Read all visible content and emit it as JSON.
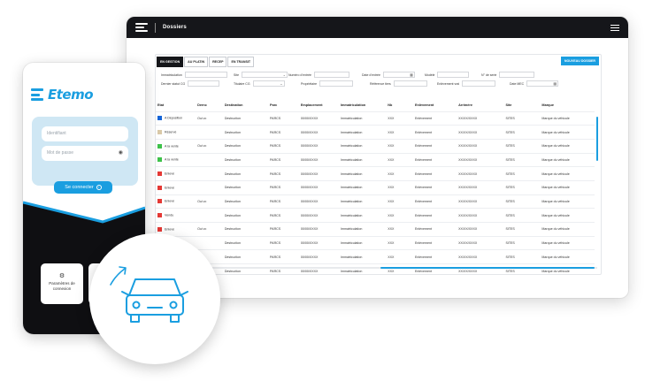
{
  "desktop": {
    "title": "Dossiers",
    "tabs": [
      "EN GESTION",
      "AU PLATIN",
      "RECEP",
      "EN TRANSIT"
    ],
    "new_button": "NOUVEAU DOSSIER",
    "filters": {
      "immatriculation": "Immatriculation",
      "site": "Site",
      "numero_entree": "Numéro d'entrée",
      "date_entree": "Date d'entrée",
      "modele": "Modèle",
      "no_serie": "N° de serie",
      "dernier_statut": "Dernier statut CG",
      "titulaire_cg": "Titulaire CG",
      "proprietaire": "Propriétaire",
      "reference_tiers": "Référence tiers",
      "enlevement_vr": "Enlèvement vrai",
      "date_mec": "Date MEC"
    },
    "columns": [
      "Etat",
      "Dernc",
      "Destination",
      "Parc",
      "Emplacement",
      "Immatriculation",
      "Nb",
      "Enlèvement",
      "Arrimère",
      "Site",
      "Marque"
    ],
    "rows": [
      {
        "etat": "A Déposition",
        "color": "#1565d8",
        "dernc": "Oui vc",
        "destination": "Destruction",
        "parc": "PARCS",
        "empl": "00/00/XXXX",
        "immat": "Immatriculation",
        "nb": "XXX",
        "enl": "Enlèvement",
        "arr": "XX/XX/XXXX",
        "site": "SITES",
        "marque": "Marque du véhicule"
      },
      {
        "etat": "Réservé",
        "color": "#d9c9a8",
        "dernc": "",
        "destination": "Destruction",
        "parc": "PARCS",
        "empl": "00/00/XXXX",
        "immat": "Immatriculation",
        "nb": "XXX",
        "enl": "Enlèvement",
        "arr": "XX/XX/XXXX",
        "site": "SITES",
        "marque": "Marque du véhicule"
      },
      {
        "etat": "A la vente",
        "color": "#3ec24a",
        "dernc": "Oui vc",
        "destination": "Destruction",
        "parc": "PARCS",
        "empl": "00/00/XXXX",
        "immat": "Immatriculation",
        "nb": "XXX",
        "enl": "Enlèvement",
        "arr": "XX/XX/XXXX",
        "site": "SITES",
        "marque": "Marque du véhicule"
      },
      {
        "etat": "A la vente",
        "color": "#3ec24a",
        "dernc": "",
        "destination": "Destruction",
        "parc": "PARCS",
        "empl": "00/00/XXXX",
        "immat": "Immatriculation",
        "nb": "XXX",
        "enl": "Enlèvement",
        "arr": "XX/XX/XXXX",
        "site": "SITES",
        "marque": "Marque du véhicule"
      },
      {
        "etat": "Enlevé",
        "color": "#e53935",
        "dernc": "",
        "destination": "Destruction",
        "parc": "PARCS",
        "empl": "00/00/XXXX",
        "immat": "Immatriculation",
        "nb": "XXX",
        "enl": "Enlèvement",
        "arr": "XX/XX/XXXX",
        "site": "SITES",
        "marque": "Marque du véhicule"
      },
      {
        "etat": "Enlevé",
        "color": "#e53935",
        "dernc": "",
        "destination": "Destruction",
        "parc": "PARCS",
        "empl": "00/00/XXXX",
        "immat": "Immatriculation",
        "nb": "XXX",
        "enl": "Enlèvement",
        "arr": "XX/XX/XXXX",
        "site": "SITES",
        "marque": "Marque du véhicule"
      },
      {
        "etat": "Enlevé",
        "color": "#e53935",
        "dernc": "Oui vc",
        "destination": "Destruction",
        "parc": "PARCS",
        "empl": "00/00/XXXX",
        "immat": "Immatriculation",
        "nb": "XXX",
        "enl": "Enlèvement",
        "arr": "XX/XX/XXXX",
        "site": "SITES",
        "marque": "Marque du véhicule"
      },
      {
        "etat": "Vendu",
        "color": "#e53935",
        "dernc": "",
        "destination": "Destruction",
        "parc": "PARCS",
        "empl": "00/00/XXXX",
        "immat": "Immatriculation",
        "nb": "XXX",
        "enl": "Enlèvement",
        "arr": "XX/XX/XXXX",
        "site": "SITES",
        "marque": "Marque du véhicule"
      },
      {
        "etat": "Enlevé",
        "color": "#e53935",
        "dernc": "Oui vc",
        "destination": "Destruction",
        "parc": "PARCS",
        "empl": "00/00/XXXX",
        "immat": "Immatriculation",
        "nb": "XXX",
        "enl": "Enlèvement",
        "arr": "XX/XX/XXXX",
        "site": "SITES",
        "marque": "Marque du véhicule"
      },
      {
        "etat": "Vendu",
        "color": "#e53935",
        "dernc": "",
        "destination": "Destruction",
        "parc": "PARCS",
        "empl": "00/00/XXXX",
        "immat": "Immatriculation",
        "nb": "XXX",
        "enl": "Enlèvement",
        "arr": "XX/XX/XXXX",
        "site": "SITES",
        "marque": "Marque du véhicule"
      },
      {
        "etat": "",
        "color": "",
        "dernc": "",
        "destination": "Destruction",
        "parc": "PARCS",
        "empl": "00/00/XXXX",
        "immat": "Immatriculation",
        "nb": "XXX",
        "enl": "Enlèvement",
        "arr": "XX/XX/XXXX",
        "site": "SITES",
        "marque": "Marque du véhicule"
      },
      {
        "etat": "",
        "color": "",
        "dernc": "",
        "destination": "Destruction",
        "parc": "PARCS",
        "empl": "00/00/XXXX",
        "immat": "Immatriculation",
        "nb": "XXX",
        "enl": "Enlèvement",
        "arr": "XX/XX/XXXX",
        "site": "SITES",
        "marque": "Marque du véhicule"
      }
    ]
  },
  "phone": {
    "logo": "Etemo",
    "identifiant_placeholder": "Identifiant",
    "password_placeholder": "Mot de passe",
    "login_button": "Se connecter",
    "settings_tile": "Paramètres de connexion"
  },
  "colors": {
    "accent": "#1a9ee0",
    "dark": "#15161a",
    "card": "#cfe7f4"
  },
  "icons": [
    "burger-menu-icon",
    "calendar-icon",
    "chevron-down-icon",
    "eye-icon",
    "arrow-right-circle-icon",
    "gear-icon",
    "car-icon"
  ]
}
